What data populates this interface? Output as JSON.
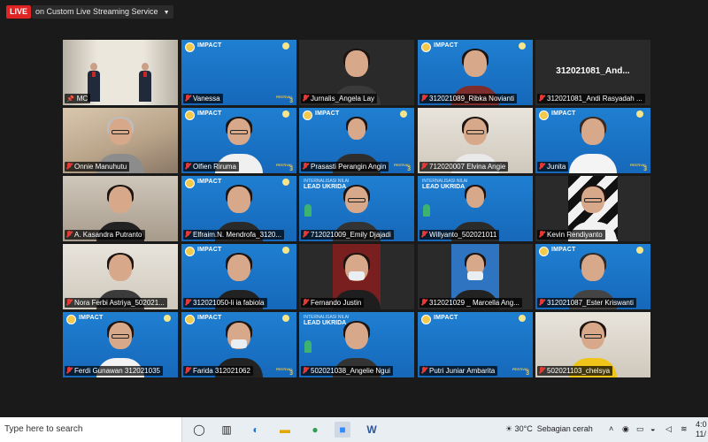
{
  "header": {
    "live_label": "LIVE",
    "stream_label": "on Custom Live Streaming Service"
  },
  "banner": {
    "impact": "IMPACT",
    "lead_top": "INTERNALISASI NILAI",
    "lead": "LEAD UKRIDA",
    "festival": "FESTIVAL",
    "festival_num": "3"
  },
  "participants": [
    {
      "name": "MC",
      "pinned": true
    },
    {
      "name": "Vanessa"
    },
    {
      "name": "Jurnalis_Angela Lay"
    },
    {
      "name": "312021089_Ribka Novianti"
    },
    {
      "name": "312021081_Andi Rasyadah ...",
      "center_label": "312021081_And..."
    },
    {
      "name": "Onnie Manuhutu"
    },
    {
      "name": "Olfien Riruma"
    },
    {
      "name": "Prasasti Perangin Angin"
    },
    {
      "name": "712020007 Elvina Angie"
    },
    {
      "name": "Junita"
    },
    {
      "name": "A. Kasandra Putranto"
    },
    {
      "name": "Elfraim.N. Mendrofa_3120..."
    },
    {
      "name": "712021009_Emily Djajadi"
    },
    {
      "name": "Willyanto_502021011"
    },
    {
      "name": "Kevin Rendiyanto"
    },
    {
      "name": "Nora Ferbi Astriya_502021..."
    },
    {
      "name": "312021050-li ia fabiola"
    },
    {
      "name": "Fernando Justin"
    },
    {
      "name": "312021029 _ Marcella Ang..."
    },
    {
      "name": "312021087_Ester Kriswanti"
    },
    {
      "name": "Ferdi Gunawan 312021035"
    },
    {
      "name": "Farida 312021062"
    },
    {
      "name": "502021038_Angelie Ngui"
    },
    {
      "name": "Putri Juniar Ambarita"
    },
    {
      "name": "502021103_chelsya"
    }
  ],
  "taskbar": {
    "search_placeholder": "Type here to search",
    "temperature": "30°C",
    "weather": "Sebagian cerah",
    "clock": "4:0",
    "date": "11/"
  }
}
